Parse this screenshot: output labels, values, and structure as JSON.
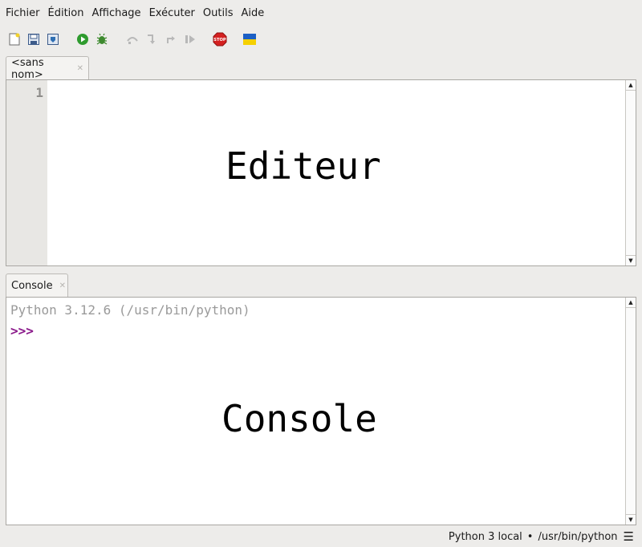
{
  "menubar": {
    "items": [
      "Fichier",
      "Édition",
      "Affichage",
      "Exécuter",
      "Outils",
      "Aide"
    ]
  },
  "toolbar": {
    "buttons": [
      {
        "icon": "new-file-icon"
      },
      {
        "icon": "open-file-icon"
      },
      {
        "icon": "save-file-icon"
      },
      {
        "icon": "run-icon"
      },
      {
        "icon": "debug-icon"
      },
      {
        "icon": "step-over-icon"
      },
      {
        "icon": "step-into-icon"
      },
      {
        "icon": "step-out-icon"
      },
      {
        "icon": "resume-icon"
      },
      {
        "icon": "stop-icon",
        "text": "STOP"
      },
      {
        "icon": "ukraine-flag-icon"
      }
    ]
  },
  "editor": {
    "tab_label": "<sans nom>",
    "line_numbers": [
      "1"
    ],
    "overlay_label": "Editeur"
  },
  "console": {
    "tab_label": "Console",
    "banner": "Python 3.12.6 (/usr/bin/python)",
    "prompt": ">>>",
    "overlay_label": "Console"
  },
  "statusbar": {
    "interpreter": "Python 3 local",
    "separator": "•",
    "path": "/usr/bin/python",
    "menu_icon": "hamburger-menu-icon"
  },
  "colors": {
    "prompt": "#8b1a8b",
    "banner": "#9a9a9a",
    "run_green": "#2e9b2e",
    "stop_red": "#d42020"
  }
}
